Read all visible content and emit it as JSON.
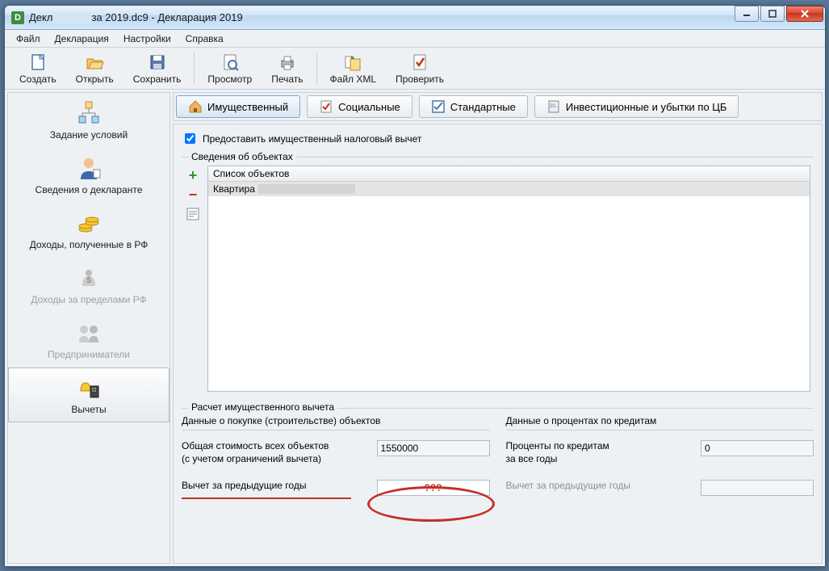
{
  "window": {
    "title_prefix": "Декл",
    "title_suffix": "за 2019.dc9 - Декларация 2019"
  },
  "menu": {
    "file": "Файл",
    "declaration": "Декларация",
    "settings": "Настройки",
    "help": "Справка"
  },
  "toolbar": {
    "create": "Создать",
    "open": "Открыть",
    "save": "Сохранить",
    "preview": "Просмотр",
    "print": "Печать",
    "xml": "Файл XML",
    "check": "Проверить"
  },
  "nav": {
    "conditions": "Задание условий",
    "declarant": "Сведения о декларанте",
    "income_rf": "Доходы, полученные в РФ",
    "income_abroad": "Доходы за пределами РФ",
    "entrepreneurs": "Предприниматели",
    "deductions": "Вычеты"
  },
  "tabs": {
    "property": "Имущественный",
    "social": "Социальные",
    "standard": "Стандартные",
    "investment": "Инвестиционные и убытки по ЦБ"
  },
  "property_panel": {
    "grant_checkbox": "Предоставить имущественный налоговый вычет",
    "objects_title": "Сведения об объектах",
    "objects_header": "Список объектов",
    "object_row_prefix": "Квартира"
  },
  "calc": {
    "title": "Расчет имущественного вычета",
    "left": {
      "head": "Данные о покупке (строительстве) объектов",
      "total_cost_l1": "Общая стоимость всех объектов",
      "total_cost_l2": "(с учетом ограничений вычета)",
      "total_cost_value": "1550000",
      "prev_years": "Вычет за предыдущие годы",
      "prev_years_value": "???"
    },
    "right": {
      "head": "Данные о процентах по кредитам",
      "interest_l1": "Проценты по кредитам",
      "interest_l2": "за все годы",
      "interest_value": "0",
      "prev_years": "Вычет за предыдущие годы",
      "prev_years_value": ""
    }
  }
}
